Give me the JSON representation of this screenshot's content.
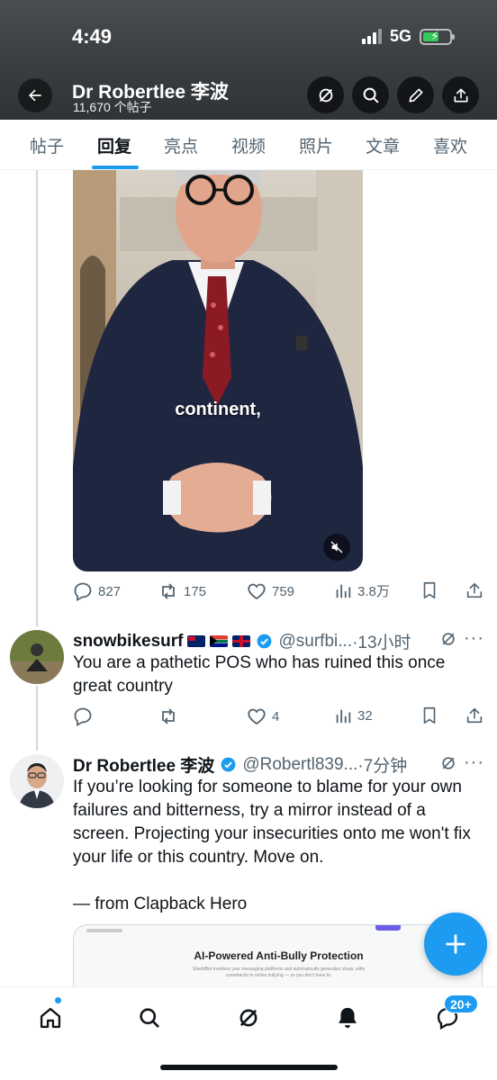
{
  "status_bar": {
    "time": "4:49",
    "network": "5G"
  },
  "header": {
    "name": "Dr Robertlee 李波",
    "post_count": "11,670 个帖子"
  },
  "tabs": [
    "帖子",
    "回复",
    "亮点",
    "视频",
    "照片",
    "文章",
    "喜欢"
  ],
  "active_tab": "回复",
  "video_post": {
    "caption": "continent,",
    "stats": {
      "replies": "827",
      "reposts": "175",
      "likes": "759",
      "views": "3.8万"
    }
  },
  "reply1": {
    "name": "snowbikesurf",
    "handle": "@surfbi...",
    "time": "·13小时",
    "text": "You are a pathetic POS who has ruined this once great country",
    "stats": {
      "replies": "",
      "reposts": "",
      "likes": "4",
      "views": "32"
    }
  },
  "reply2": {
    "name": "Dr Robertlee 李波",
    "handle": "@Robertl839...",
    "time": "·7分钟",
    "text": "If you’re looking for someone to blame for your own failures and bitterness, try a mirror instead of a screen. Projecting your insecurities onto me won't fix your life or this country. Move on.",
    "signature": "— from Clapback Hero",
    "card_title": "AI-Powered Anti-Bully Protection",
    "card_subtitle": "ShieldBot monitors your messaging platforms and automatically generates sharp, witty comebacks to online bullying — so you don't have to."
  },
  "bottom_nav": {
    "messages_badge": "20+"
  },
  "colors": {
    "accent": "#1d9bf0",
    "text": "#0f1419",
    "muted": "#536471"
  }
}
